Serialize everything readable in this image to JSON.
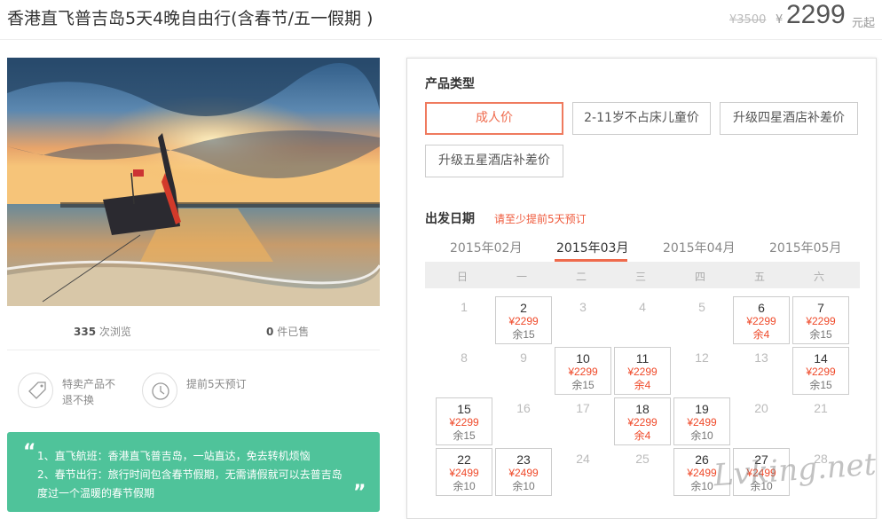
{
  "header": {
    "title": "香港直飞普吉岛5天4晚自由行(含春节/五一假期 )",
    "old_price": "¥3500",
    "currency": "¥",
    "price": "2299",
    "price_unit": "元起"
  },
  "stats": {
    "views": "335",
    "views_label": "次浏览",
    "sold": "0",
    "sold_label": "件已售"
  },
  "features": [
    {
      "icon": "tag-icon",
      "text": "特卖产品不退不换"
    },
    {
      "icon": "clock-icon",
      "text": "提前5天预订"
    }
  ],
  "highlights": {
    "line1": "1、直飞航班：香港直飞普吉岛，一站直达，免去转机烦恼",
    "line2": "2、春节出行：旅行时间包含春节假期，无需请假就可以去普吉岛",
    "line3": "度过一个温暖的春节假期"
  },
  "booking": {
    "product_type_title": "产品类型",
    "product_types": [
      "成人价",
      "2-11岁不占床儿童价",
      "升级四星酒店补差价",
      "升级五星酒店补差价"
    ],
    "selected_type": "成人价",
    "date_title": "出发日期",
    "advance_note": "请至少提前5天预订",
    "months": [
      "2015年02月",
      "2015年03月",
      "2015年04月",
      "2015年05月"
    ],
    "active_month": "2015年03月",
    "weekdays": [
      "日",
      "一",
      "二",
      "三",
      "四",
      "五",
      "六"
    ],
    "calendar": [
      {
        "day": "1"
      },
      {
        "day": "2",
        "price": "¥2299",
        "remain": "余15"
      },
      {
        "day": "3"
      },
      {
        "day": "4"
      },
      {
        "day": "5"
      },
      {
        "day": "6",
        "price": "¥2299",
        "remain": "余4"
      },
      {
        "day": "7",
        "price": "¥2299",
        "remain": "余15"
      },
      {
        "day": "8"
      },
      {
        "day": "9"
      },
      {
        "day": "10",
        "price": "¥2299",
        "remain": "余15"
      },
      {
        "day": "11",
        "price": "¥2299",
        "remain": "余4"
      },
      {
        "day": "12"
      },
      {
        "day": "13"
      },
      {
        "day": "14",
        "price": "¥2299",
        "remain": "余15"
      },
      {
        "day": "15",
        "price": "¥2299",
        "remain": "余15"
      },
      {
        "day": "16"
      },
      {
        "day": "17"
      },
      {
        "day": "18",
        "price": "¥2299",
        "remain": "余4"
      },
      {
        "day": "19",
        "price": "¥2499",
        "remain": "余10"
      },
      {
        "day": "20"
      },
      {
        "day": "21"
      },
      {
        "day": "22",
        "price": "¥2499",
        "remain": "余10"
      },
      {
        "day": "23",
        "price": "¥2499",
        "remain": "余10"
      },
      {
        "day": "24"
      },
      {
        "day": "25"
      },
      {
        "day": "26",
        "price": "¥2499",
        "remain": "余10"
      },
      {
        "day": "27",
        "price": "¥2499",
        "remain": "余10"
      },
      {
        "day": "28"
      }
    ]
  },
  "watermark": "Lvking.net",
  "colors": {
    "accent": "#ef6a4c",
    "green": "#4fc39a"
  }
}
